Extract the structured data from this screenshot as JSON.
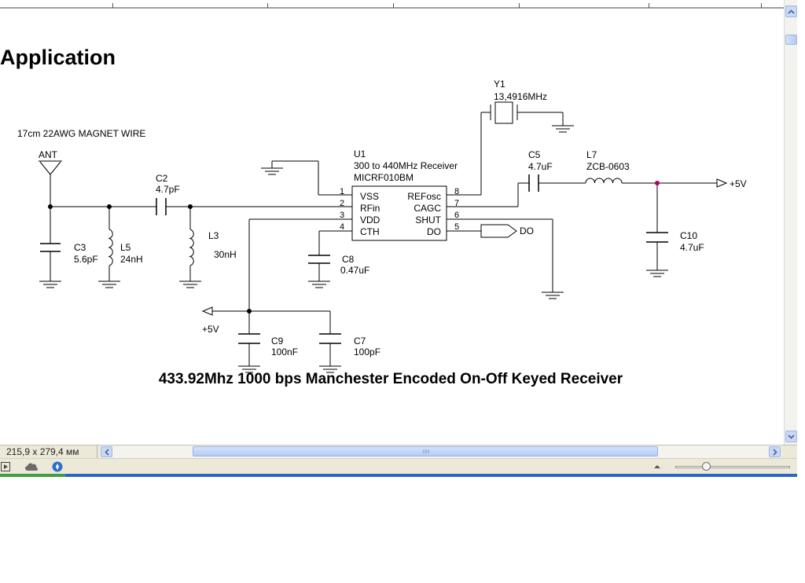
{
  "document": {
    "section_heading": "Application",
    "caption": "433.92Mhz 1000 bps Manchester Encoded On-Off Keyed Receiver"
  },
  "schematic": {
    "antenna": {
      "label": "ANT",
      "wire_note": "17cm 22AWG MAGNET WIRE"
    },
    "c2": {
      "ref": "C2",
      "value": "4.7pF"
    },
    "c3": {
      "ref": "C3",
      "value": "5.6pF"
    },
    "l5": {
      "ref": "L5",
      "value": "24nH"
    },
    "l3": {
      "ref": "L3",
      "value": "30nH"
    },
    "u1": {
      "ref": "U1",
      "desc": "300 to 440MHz Receiver",
      "part": "MICRF010BM",
      "pins_left": [
        {
          "num": "1",
          "name": "VSS"
        },
        {
          "num": "2",
          "name": "RFin"
        },
        {
          "num": "3",
          "name": "VDD"
        },
        {
          "num": "4",
          "name": "CTH"
        }
      ],
      "pins_right": [
        {
          "num": "8",
          "name": "REFosc"
        },
        {
          "num": "7",
          "name": "CAGC"
        },
        {
          "num": "6",
          "name": "SHUT"
        },
        {
          "num": "5",
          "name": "DO"
        }
      ]
    },
    "y1": {
      "ref": "Y1",
      "value": "13,4916MHz"
    },
    "c5": {
      "ref": "C5",
      "value": "4.7uF"
    },
    "l7": {
      "ref": "L7",
      "value": "ZCB-0603"
    },
    "c10": {
      "ref": "C10",
      "value": "4.7uF"
    },
    "c8": {
      "ref": "C8",
      "value": "0.47uF"
    },
    "c9": {
      "ref": "C9",
      "value": "100nF"
    },
    "c7": {
      "ref": "C7",
      "value": "100pF"
    },
    "vcc_top": "+5V",
    "vcc_bottom": "+5V",
    "do_port": "DO"
  },
  "statusbar": {
    "page_size": "215,9 x 279,4 мм"
  },
  "icons": {
    "scroll_up": "chevron-up-icon",
    "scroll_down": "chevron-down-icon",
    "scroll_left": "chevron-left-icon",
    "scroll_right": "chevron-right-icon",
    "play": "play-icon",
    "cloud": "cloud-icon",
    "compass": "compass-icon",
    "zoom_menu": "triangle-up-icon"
  },
  "colors": {
    "junction_highlight": "#b0006a",
    "taskbar_blue": "#2a66c8",
    "start_green": "#3f9e3f"
  }
}
